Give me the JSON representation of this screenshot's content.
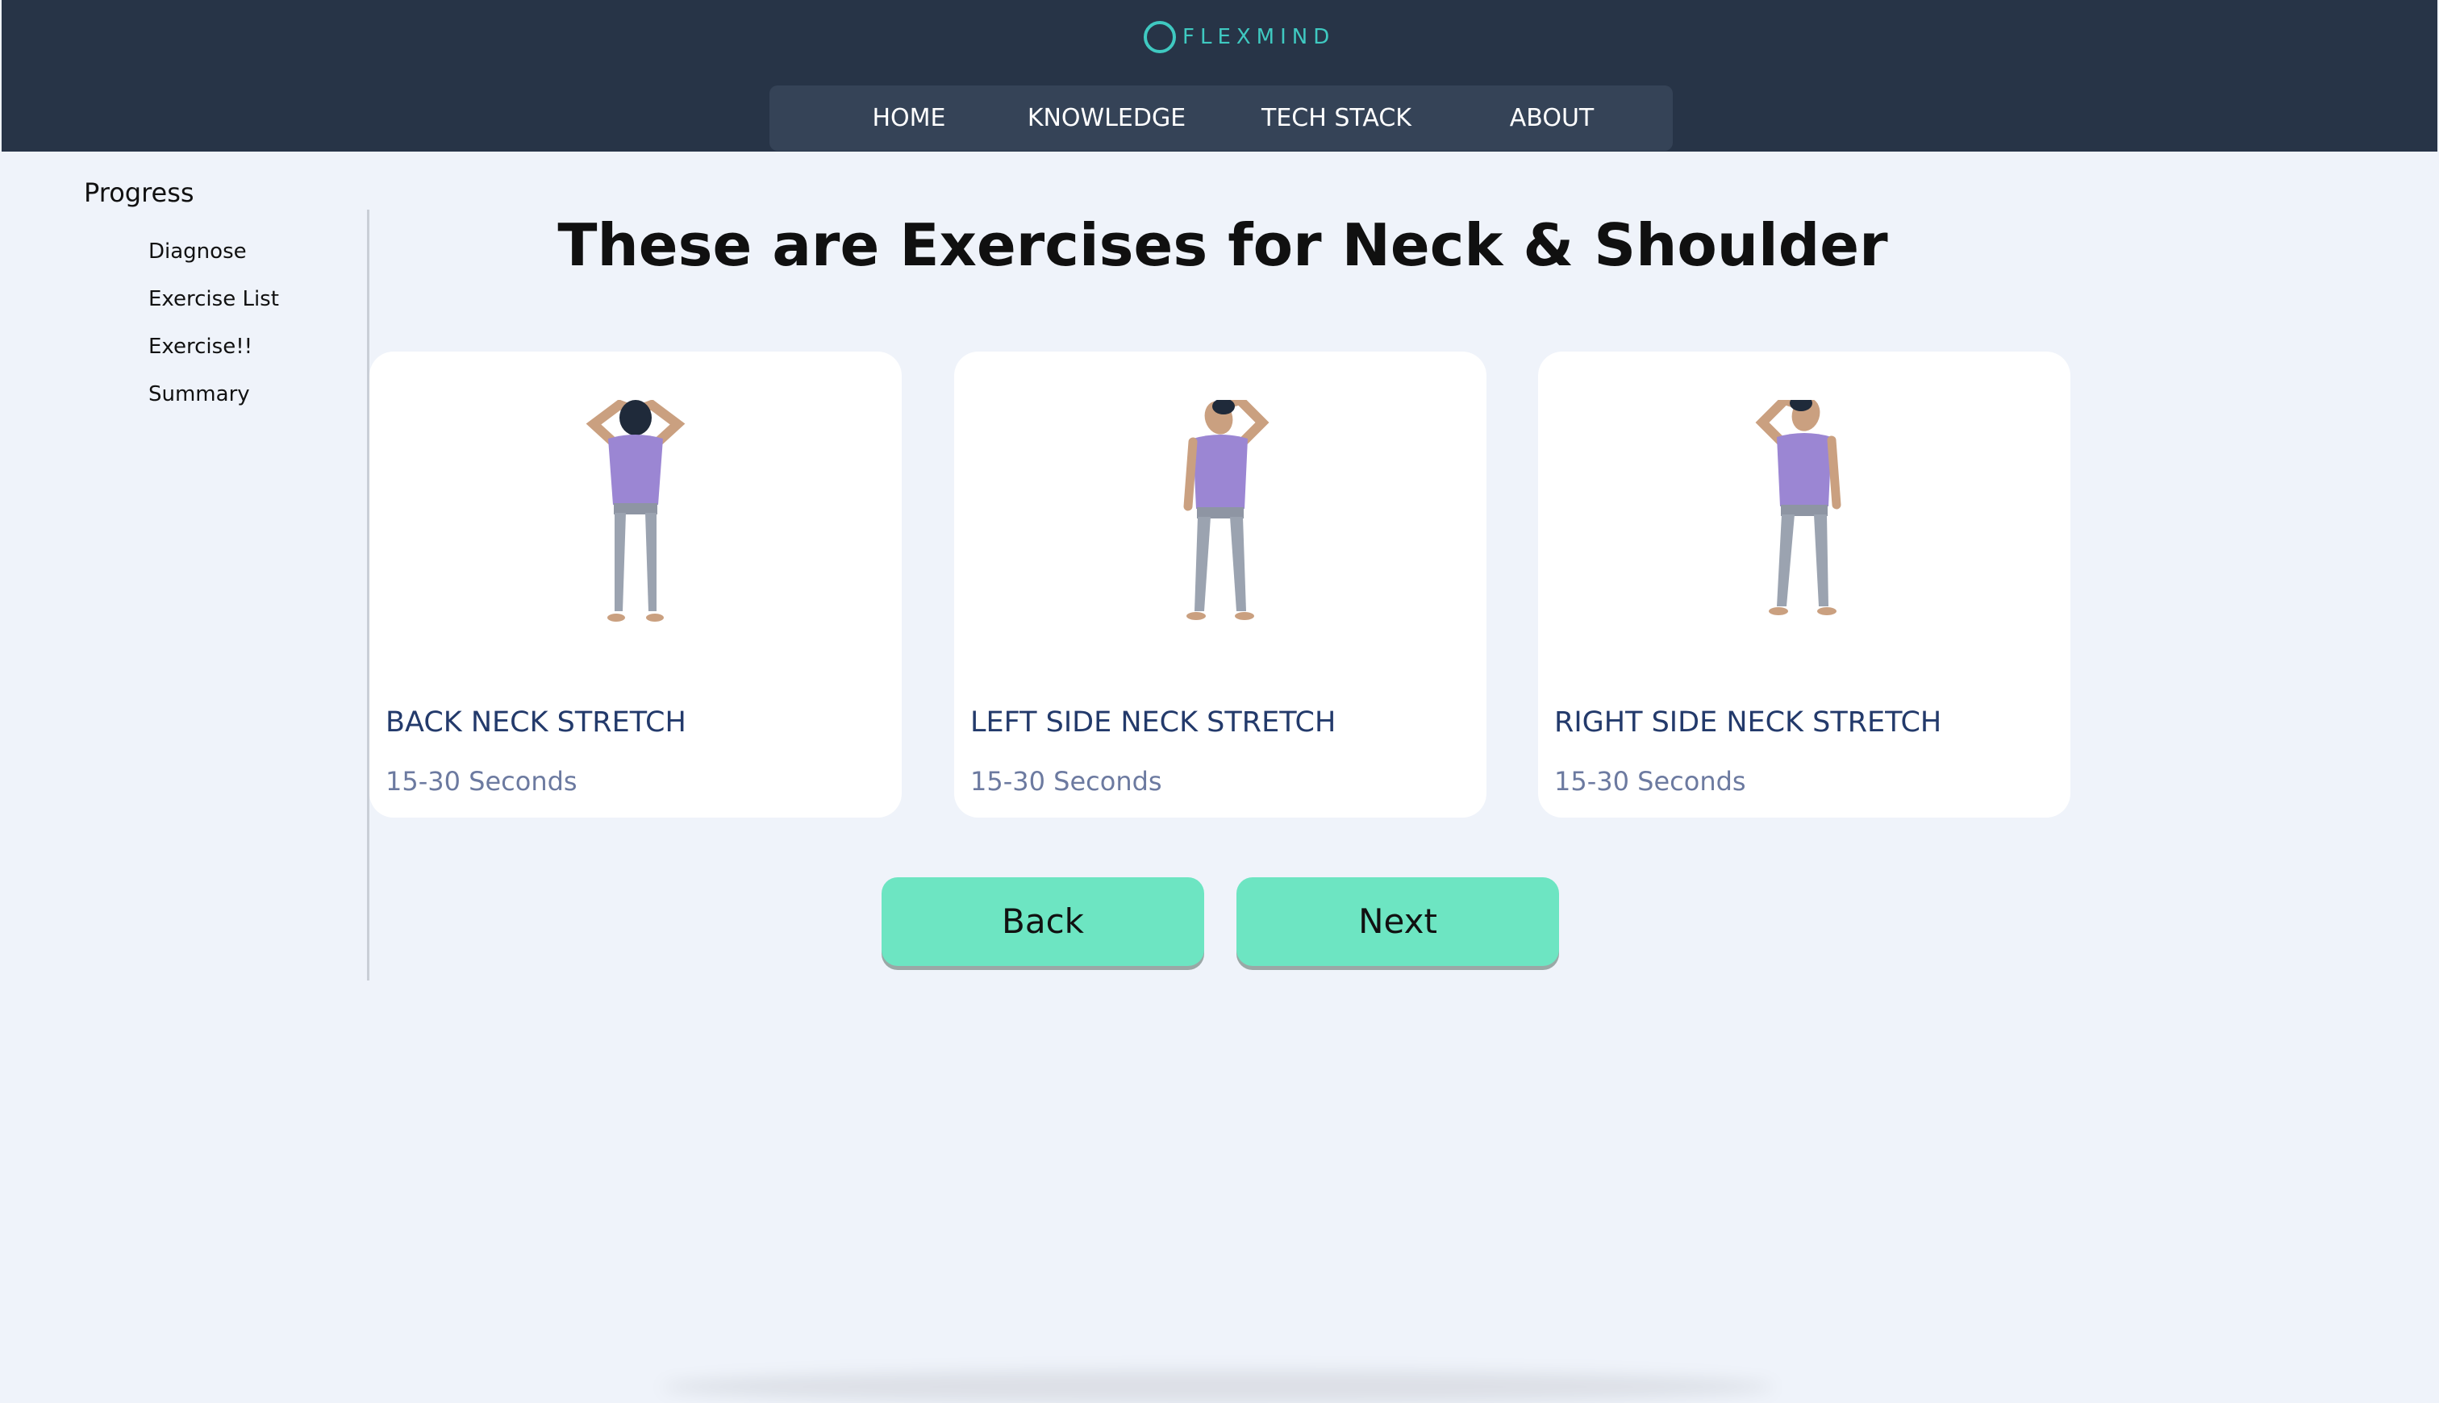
{
  "header": {
    "logo_text": "FLEXMIND",
    "nav": [
      "HOME",
      "KNOWLEDGE",
      "TECH STACK",
      "ABOUT"
    ]
  },
  "sidebar": {
    "title": "Progress",
    "items": [
      "Diagnose",
      "Exercise List",
      "Exercise!!",
      "Summary"
    ]
  },
  "main": {
    "title": "These are Exercises for Neck & Shoulder",
    "cards": [
      {
        "name": "BACK NECK STRETCH",
        "duration": "15-30 Seconds",
        "pose": "back-neck"
      },
      {
        "name": "LEFT SIDE NECK STRETCH",
        "duration": "15-30 Seconds",
        "pose": "left-side"
      },
      {
        "name": "RIGHT SIDE NECK STRETCH",
        "duration": "15-30 Seconds",
        "pose": "right-side"
      }
    ],
    "back_label": "Back",
    "next_label": "Next"
  },
  "colors": {
    "header_bg": "#273447",
    "nav_bg": "#354357",
    "page_bg": "#eff3fa",
    "button": "#6de5c2",
    "accent": "#3fc9c1",
    "card_title": "#233a6b",
    "shirt": "#9b86d3"
  }
}
